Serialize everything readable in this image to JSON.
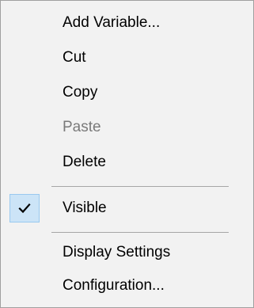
{
  "menu": {
    "items": [
      {
        "label": "Add Variable...",
        "enabled": true
      },
      {
        "label": "Cut",
        "enabled": true
      },
      {
        "label": "Copy",
        "enabled": true
      },
      {
        "label": "Paste",
        "enabled": false
      },
      {
        "label": "Delete",
        "enabled": true
      },
      {
        "label": "Visible",
        "enabled": true,
        "checked": true
      },
      {
        "label": "Display Settings",
        "enabled": true
      },
      {
        "label": "Configuration...",
        "enabled": true
      }
    ]
  },
  "icons": {
    "check": "checkmark-icon"
  },
  "colors": {
    "menu_background": "#f2f2f2",
    "check_highlight": "#cce4f7",
    "disabled_text": "#7a7a7a"
  }
}
